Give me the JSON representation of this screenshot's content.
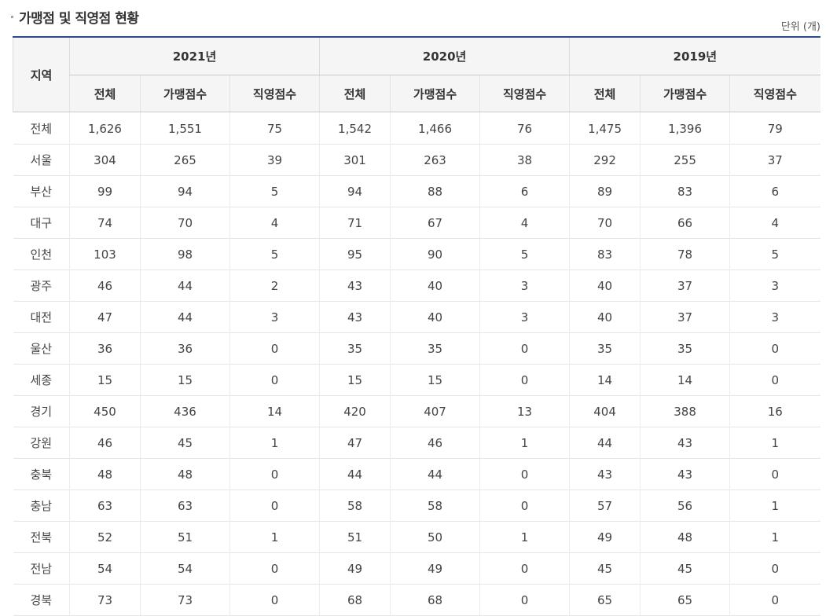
{
  "title": "가맹점 및 직영점 현황",
  "unit": "단위 (개)",
  "table": {
    "region_header": "지역",
    "years": [
      "2021년",
      "2020년",
      "2019년"
    ],
    "subheaders": [
      "전체",
      "가맹점수",
      "직영점수"
    ],
    "rows": [
      [
        "전체",
        "1,626",
        "1,551",
        "75",
        "1,542",
        "1,466",
        "76",
        "1,475",
        "1,396",
        "79"
      ],
      [
        "서울",
        "304",
        "265",
        "39",
        "301",
        "263",
        "38",
        "292",
        "255",
        "37"
      ],
      [
        "부산",
        "99",
        "94",
        "5",
        "94",
        "88",
        "6",
        "89",
        "83",
        "6"
      ],
      [
        "대구",
        "74",
        "70",
        "4",
        "71",
        "67",
        "4",
        "70",
        "66",
        "4"
      ],
      [
        "인천",
        "103",
        "98",
        "5",
        "95",
        "90",
        "5",
        "83",
        "78",
        "5"
      ],
      [
        "광주",
        "46",
        "44",
        "2",
        "43",
        "40",
        "3",
        "40",
        "37",
        "3"
      ],
      [
        "대전",
        "47",
        "44",
        "3",
        "43",
        "40",
        "3",
        "40",
        "37",
        "3"
      ],
      [
        "울산",
        "36",
        "36",
        "0",
        "35",
        "35",
        "0",
        "35",
        "35",
        "0"
      ],
      [
        "세종",
        "15",
        "15",
        "0",
        "15",
        "15",
        "0",
        "14",
        "14",
        "0"
      ],
      [
        "경기",
        "450",
        "436",
        "14",
        "420",
        "407",
        "13",
        "404",
        "388",
        "16"
      ],
      [
        "강원",
        "46",
        "45",
        "1",
        "47",
        "46",
        "1",
        "44",
        "43",
        "1"
      ],
      [
        "충북",
        "48",
        "48",
        "0",
        "44",
        "44",
        "0",
        "43",
        "43",
        "0"
      ],
      [
        "충남",
        "63",
        "63",
        "0",
        "58",
        "58",
        "0",
        "57",
        "56",
        "1"
      ],
      [
        "전북",
        "52",
        "51",
        "1",
        "51",
        "50",
        "1",
        "49",
        "48",
        "1"
      ],
      [
        "전남",
        "54",
        "54",
        "0",
        "49",
        "49",
        "0",
        "45",
        "45",
        "0"
      ],
      [
        "경북",
        "73",
        "73",
        "0",
        "68",
        "68",
        "0",
        "65",
        "65",
        "0"
      ]
    ]
  }
}
